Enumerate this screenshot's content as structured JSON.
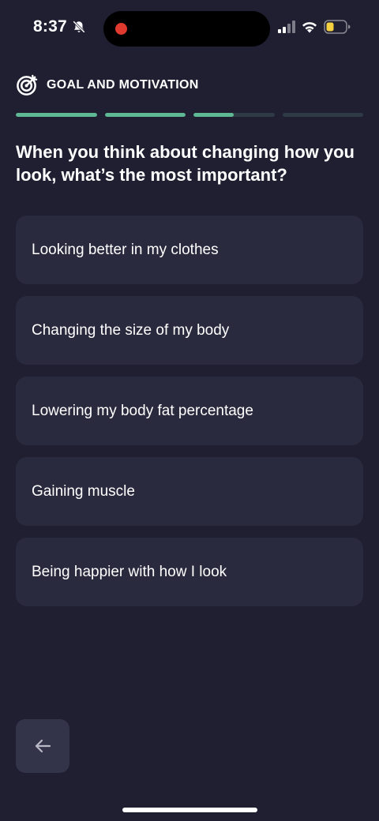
{
  "status_bar": {
    "time": "8:37",
    "icons": [
      "bell-slash-icon",
      "signal-icon",
      "wifi-icon",
      "battery-icon"
    ],
    "battery_color": "#f5d142",
    "record_color": "#e0392e"
  },
  "header": {
    "icon": "target-icon",
    "section_label": "GOAL AND MOTIVATION"
  },
  "progress": {
    "segments": [
      1,
      1,
      0.5,
      0
    ]
  },
  "question": "When you think about changing how you look, what’s the most important?",
  "options": [
    {
      "label": "Looking better in my clothes"
    },
    {
      "label": "Changing the size of my body"
    },
    {
      "label": "Lowering my body fat percentage"
    },
    {
      "label": "Gaining muscle"
    },
    {
      "label": "Being happier with how I look"
    }
  ],
  "navigation": {
    "back_icon": "arrow-left-icon"
  },
  "colors": {
    "background": "#1f1f31",
    "card": "#2a2a3e",
    "accent": "#5fb894",
    "track": "#2e3a45",
    "button": "#33334a"
  }
}
